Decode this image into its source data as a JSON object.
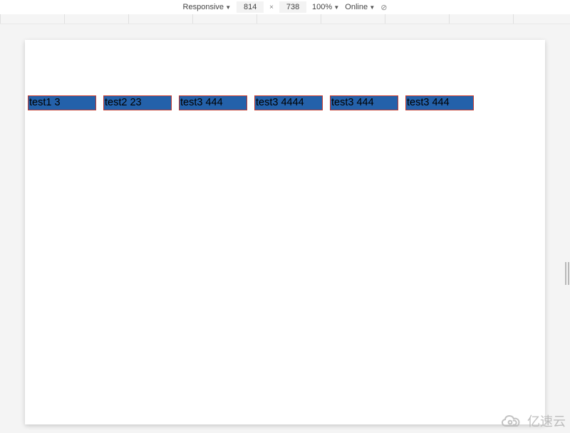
{
  "toolbar": {
    "mode_label": "Responsive",
    "width": "814",
    "height": "738",
    "zoom_label": "100%",
    "network_label": "Online"
  },
  "page": {
    "items": [
      {
        "label": "test1 3"
      },
      {
        "label": "test2 23"
      },
      {
        "label": "test3 444"
      },
      {
        "label": "test3 4444"
      },
      {
        "label": "test3 444"
      },
      {
        "label": "test3 444"
      }
    ]
  },
  "watermark": {
    "text": "亿速云"
  },
  "colors": {
    "cell_bg": "#2461aa",
    "cell_border": "#c33a2f"
  }
}
